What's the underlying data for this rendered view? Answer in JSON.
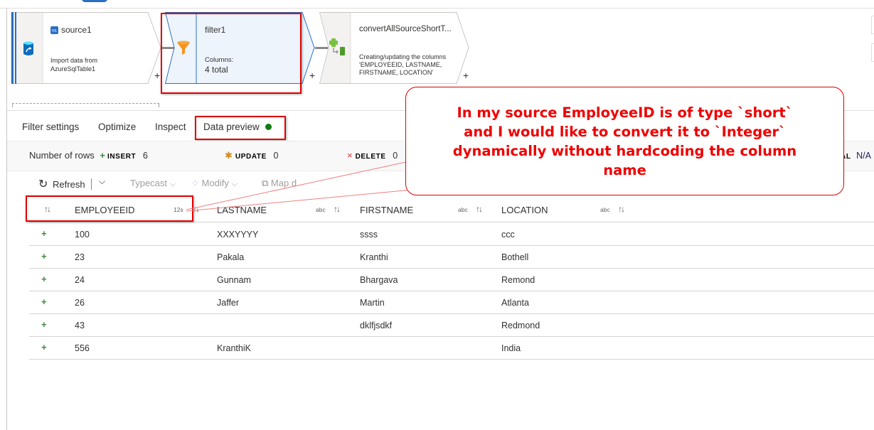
{
  "pipeline": {
    "nodes": [
      {
        "name": "source1",
        "description_lines": [
          "Import data from",
          "AzureSqlTable1"
        ],
        "icon": "sql-database-icon"
      },
      {
        "name": "filter1",
        "columns_label": "Columns:",
        "columns_value": "4 total",
        "icon": "funnel-icon"
      },
      {
        "name": "convertAllSourceShortT...",
        "description_lines": [
          "Creating/updating the columns",
          "'EMPLOYEEID, LASTNAME,",
          "FIRSTNAME, LOCATION'"
        ],
        "icon": "derived-column-icon"
      }
    ],
    "add_symbol": "+"
  },
  "tabs": [
    {
      "label": "Filter settings"
    },
    {
      "label": "Optimize"
    },
    {
      "label": "Inspect"
    },
    {
      "label": "Data preview",
      "active": true,
      "status": "ready"
    }
  ],
  "summary": {
    "label": "Number of rows",
    "insert_key": "INSERT",
    "insert_value": "6",
    "update_key": "UPDATE",
    "update_value": "0",
    "delete_key": "DELETE",
    "delete_value": "0",
    "partial_key": "AL",
    "partial_value": "N/A"
  },
  "toolbar": {
    "refresh": "Refresh",
    "typecast": "Typecast",
    "modify": "Modify",
    "map_drifted": "Map d"
  },
  "grid": {
    "columns": [
      {
        "name": "EMPLOYEEID",
        "type": "12s"
      },
      {
        "name": "LASTNAME",
        "type": "abc"
      },
      {
        "name": "FIRSTNAME",
        "type": "abc"
      },
      {
        "name": "LOCATION",
        "type": "abc"
      }
    ],
    "rows": [
      {
        "status": "+",
        "cells": [
          "100",
          "XXXYYYY",
          "ssss",
          "ccc"
        ]
      },
      {
        "status": "+",
        "cells": [
          "23",
          "Pakala",
          "Kranthi",
          "Bothell"
        ]
      },
      {
        "status": "+",
        "cells": [
          "24",
          "Gunnam",
          "Bhargava",
          "Remond"
        ]
      },
      {
        "status": "+",
        "cells": [
          "26",
          "Jaffer",
          "Martin",
          "Atlanta"
        ]
      },
      {
        "status": "+",
        "cells": [
          "43",
          "",
          "dklfjsdkf",
          "Redmond"
        ]
      },
      {
        "status": "+",
        "cells": [
          "556",
          "KranthiK",
          "",
          "India"
        ]
      }
    ]
  },
  "annotation": {
    "text_lines": [
      "In my source EmployeeID is of type `short`",
      "and I would like to convert it to `Integer`",
      "dynamically without hardcoding the column",
      "name"
    ],
    "color": "#ee0000"
  }
}
